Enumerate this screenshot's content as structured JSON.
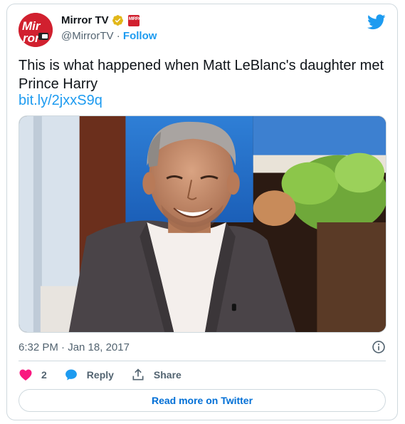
{
  "author": {
    "name": "Mirror TV",
    "handle": "@MirrorTV",
    "separator": "·",
    "follow_label": "Follow",
    "affiliate_badge_text": "MIRROR",
    "avatar_text": "Mirror"
  },
  "tweet": {
    "text": "This is what happened when Matt LeBlanc's daughter met Prince Harry",
    "link": "bit.ly/2jxxS9q",
    "timestamp": "6:32 PM · Jan 18, 2017"
  },
  "actions": {
    "like_count": "2",
    "reply_label": "Reply",
    "share_label": "Share"
  },
  "read_more_label": "Read more on Twitter",
  "colors": {
    "brand_blue": "#1d9bf0",
    "like_pink": "#f91880",
    "mirror_red": "#d1202f",
    "verified_gold": "#e2b719"
  },
  "icons": [
    "twitter-bird-icon",
    "verified-icon",
    "info-icon",
    "heart-icon",
    "reply-bubble-icon",
    "share-icon"
  ]
}
